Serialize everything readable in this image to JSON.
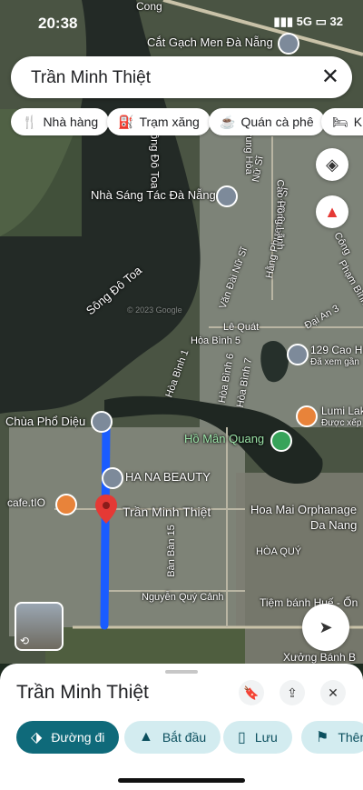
{
  "status": {
    "time": "20:38",
    "network": "5G",
    "battery": "32"
  },
  "search": {
    "query": "Trần Minh Thiệt",
    "clear_icon": "close-icon"
  },
  "chips": [
    {
      "label": "Nhà hàng",
      "icon": "restaurant-icon"
    },
    {
      "label": "Trạm xăng",
      "icon": "gas-station-icon"
    },
    {
      "label": "Quán cà phê",
      "icon": "coffee-icon"
    },
    {
      "label": "Kh",
      "icon": "hotel-icon"
    }
  ],
  "map": {
    "labels": {
      "top_cong": "Cong",
      "cat_gach": "Cắt Gạch Men Đà Nẵng",
      "nha_sang_tac": "Nhà Sáng Tác Đà Nẵng",
      "song_do_toa": "Sông Đô Toa",
      "dong_do_toa": "ông Đô Toa",
      "copyright": "© 2023 Google",
      "trung_hoa": "Trung Hòa",
      "van_dai": "Văn Đài Nữ Sĩ",
      "hang_phuong": "Hằng Phương Nữ Sĩ",
      "nu_si": "Nữ Sĩ",
      "cao_hong_lanh": "Cao Hồng Lãnh",
      "cong": "Công",
      "pham_binh": "Phạm Bình",
      "dai_an": "Đại An 3",
      "le_quat": "Lê Quát",
      "hoa_binh_5": "Hòa Bình 5",
      "hoa_binh_1": "Hòa Bình 1",
      "hoa_binh_6": "Hòa Bình 6",
      "hoa_binh_7": "Hòa Bình 7",
      "cao_h": "129 Cao H",
      "da_xem": "Đã xem gần",
      "lumi": "Lumi Lak",
      "duoc_xep": "Được xếp",
      "chua_pho_dieu": "Chùa Phổ Diệu",
      "ho_man_quang": "Hồ Mân Quang",
      "ha_na": "HA NA BEAUTY",
      "cafe": "cafe.tIO",
      "tran_minh_thiet": "Trần Minh Thiệt",
      "hoa_mai": "Hoa Mai Orphanage",
      "da_nang": "Da Nang",
      "ban_ban": "Bàn Bàn 15",
      "hoa_quy": "HÒA QUÝ",
      "nguyen_quy_canh": "Nguyễn Quý Cảnh",
      "tiem_banh": "Tiệm bánh Huế - Ốn",
      "xuong_banh": "Xưởng Bánh B"
    }
  },
  "sheet": {
    "title": "Trần Minh Thiệt",
    "actions": [
      {
        "label": "Đường đi",
        "icon": "directions-icon"
      },
      {
        "label": "Bắt đầu",
        "icon": "navigation-icon"
      },
      {
        "label": "Lưu",
        "icon": "bookmark-icon"
      },
      {
        "label": "Thêm",
        "icon": "flag-icon"
      }
    ]
  },
  "colors": {
    "route": "#1a5cff",
    "accent": "#0f6a7a",
    "pin_red": "#e53935"
  }
}
